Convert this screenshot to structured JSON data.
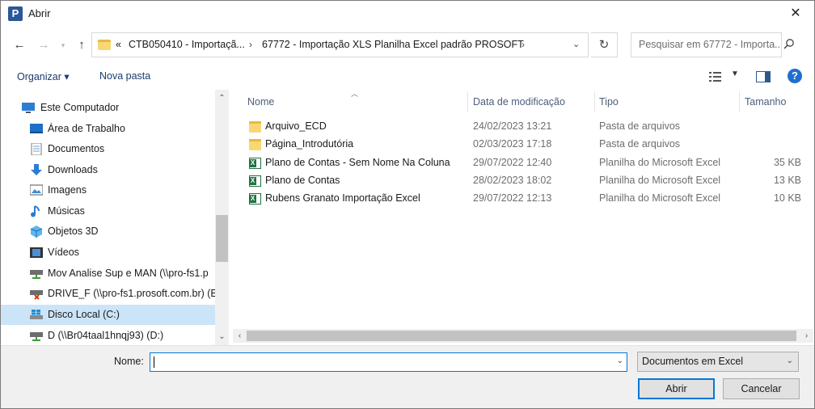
{
  "window": {
    "title": "Abrir",
    "app_icon": "P"
  },
  "address": {
    "prefix": "«",
    "segments": [
      "CTB050410 - Importaçã...",
      "67772 - Importação XLS Planilha Excel padrão PROSOFT"
    ],
    "separator": "›"
  },
  "search": {
    "placeholder": "Pesquisar em 67772 - Importa..."
  },
  "toolbar": {
    "organize_label": "Organizar ▾",
    "new_folder_label": "Nova pasta"
  },
  "nav": {
    "items": [
      {
        "label": "Este Computador",
        "icon": "computer-icon"
      },
      {
        "label": "Área de Trabalho",
        "icon": "desktop-icon"
      },
      {
        "label": "Documentos",
        "icon": "documents-icon"
      },
      {
        "label": "Downloads",
        "icon": "downloads-icon"
      },
      {
        "label": "Imagens",
        "icon": "pictures-icon"
      },
      {
        "label": "Músicas",
        "icon": "music-icon"
      },
      {
        "label": "Objetos 3D",
        "icon": "objects3d-icon"
      },
      {
        "label": "Vídeos",
        "icon": "videos-icon"
      },
      {
        "label": "Mov Analise Sup e MAN (\\\\pro-fs1.p",
        "icon": "network-drive-icon"
      },
      {
        "label": "DRIVE_F (\\\\pro-fs1.prosoft.com.br) (E",
        "icon": "network-drive-disconnected-icon"
      },
      {
        "label": "Disco Local (C:)",
        "icon": "local-disk-icon"
      },
      {
        "label": "D (\\\\Br04taal1hnqj93) (D:)",
        "icon": "network-drive-icon"
      }
    ]
  },
  "columns": {
    "name": "Nome",
    "date": "Data de modificação",
    "type": "Tipo",
    "size": "Tamanho"
  },
  "files": [
    {
      "name": "Arquivo_ECD",
      "date": "24/02/2023 13:21",
      "type": "Pasta de arquivos",
      "size": "",
      "kind": "folder"
    },
    {
      "name": "Página_Introdutória",
      "date": "02/03/2023 17:18",
      "type": "Pasta de arquivos",
      "size": "",
      "kind": "folder"
    },
    {
      "name": "Plano de Contas - Sem Nome Na Coluna",
      "date": "29/07/2022 12:40",
      "type": "Planilha do Microsoft Excel",
      "size": "35 KB",
      "kind": "excel"
    },
    {
      "name": "Plano de Contas",
      "date": "28/02/2023 18:02",
      "type": "Planilha do Microsoft Excel",
      "size": "13 KB",
      "kind": "excel"
    },
    {
      "name": "Rubens Granato Importação Excel",
      "date": "29/07/2022 12:13",
      "type": "Planilha do Microsoft Excel",
      "size": "10 KB",
      "kind": "excel"
    }
  ],
  "footer": {
    "name_label": "Nome:",
    "name_value": "",
    "file_type": "Documentos em Excel",
    "open_label": "Abrir",
    "cancel_label": "Cancelar"
  },
  "colors": {
    "accent": "#0078d7",
    "selected_bg": "#cce4f7"
  }
}
